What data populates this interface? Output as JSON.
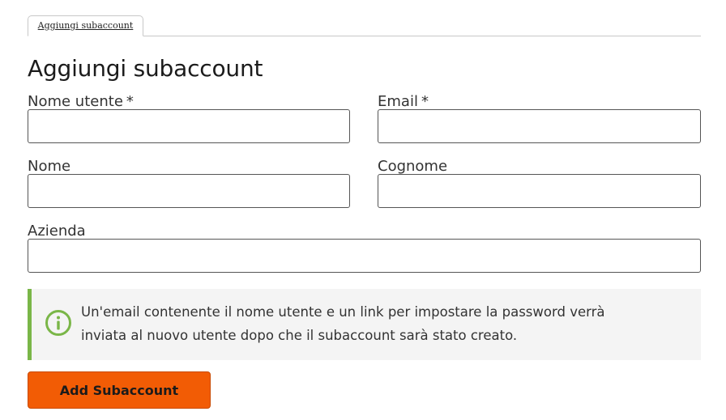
{
  "tabs": [
    {
      "label": "Aggiungi subaccount",
      "active": true
    }
  ],
  "page": {
    "title": "Aggiungi subaccount"
  },
  "form": {
    "username": {
      "label": "Nome utente",
      "required_mark": "*",
      "value": ""
    },
    "email": {
      "label": "Email",
      "required_mark": "*",
      "value": ""
    },
    "first_name": {
      "label": "Nome",
      "value": ""
    },
    "last_name": {
      "label": "Cognome",
      "value": ""
    },
    "company": {
      "label": "Azienda",
      "value": ""
    }
  },
  "info": {
    "icon": "info-circle-icon",
    "text_line1": "Un'email contenente il nome utente e un link per impostare la password verrà",
    "text_line2": "inviata al nuovo utente dopo che il subaccount sarà stato creato."
  },
  "actions": {
    "submit_label": "Add Subaccount"
  },
  "colors": {
    "accent_button": "#f25c05",
    "info_border": "#7ab648",
    "info_background": "#f4f4f4"
  }
}
